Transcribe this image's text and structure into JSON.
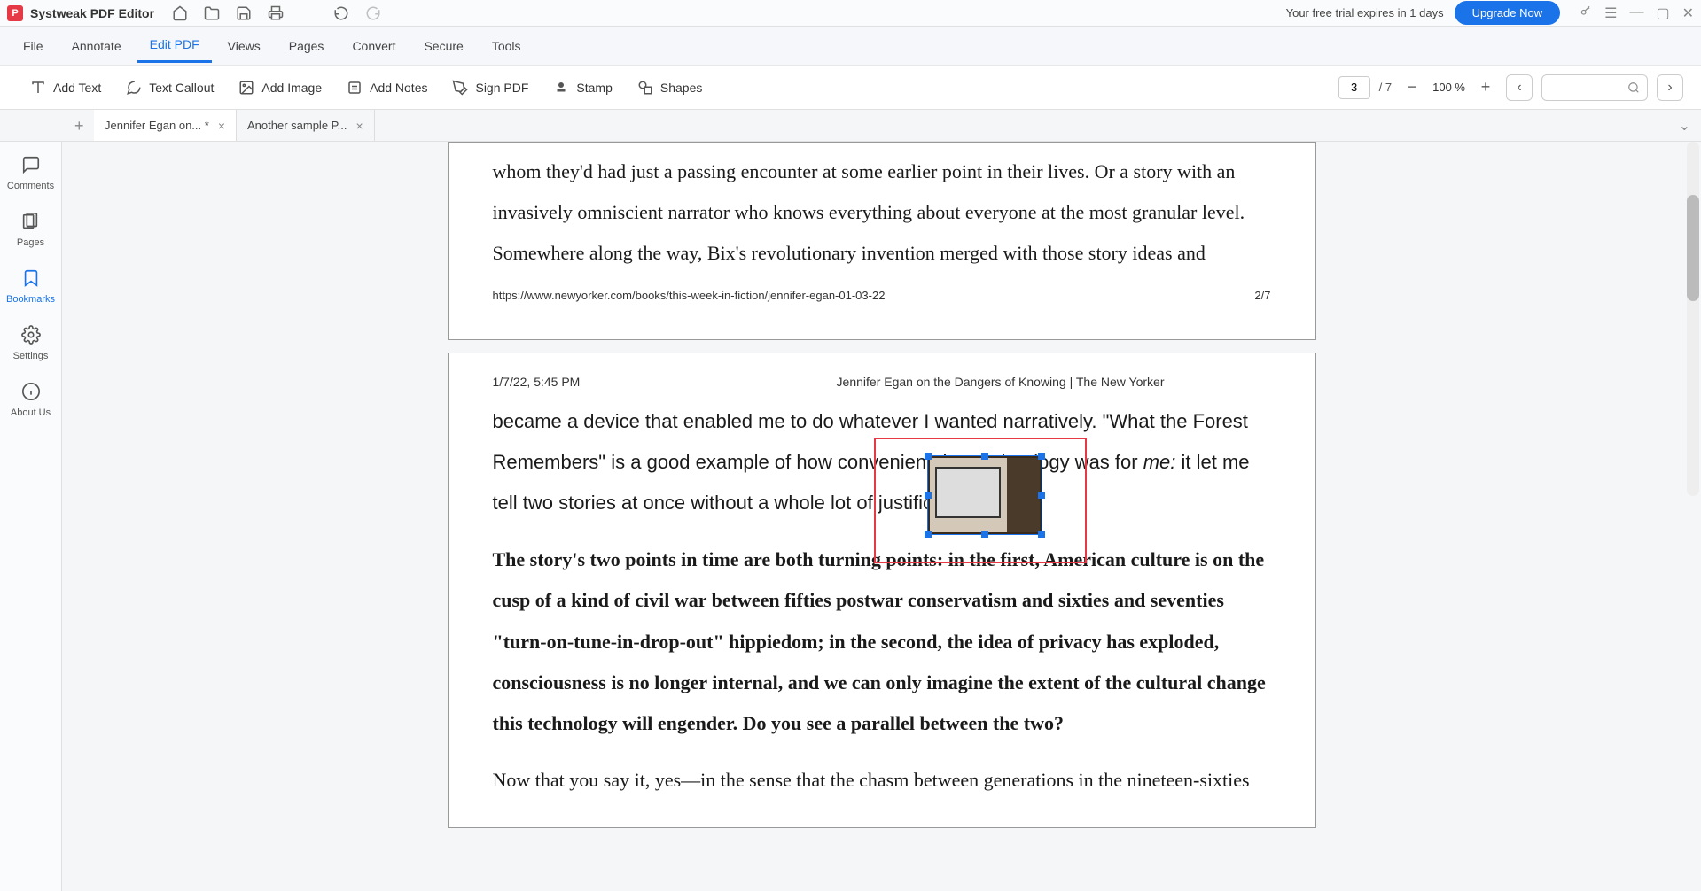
{
  "app": {
    "title": "Systweak PDF Editor",
    "trial": "Your free trial expires in 1 days",
    "upgrade": "Upgrade Now"
  },
  "menu": {
    "file": "File",
    "annotate": "Annotate",
    "edit": "Edit PDF",
    "views": "Views",
    "pages": "Pages",
    "convert": "Convert",
    "secure": "Secure",
    "tools": "Tools"
  },
  "tools": {
    "addtext": "Add Text",
    "callout": "Text Callout",
    "addimage": "Add Image",
    "addnotes": "Add Notes",
    "signpdf": "Sign PDF",
    "stamp": "Stamp",
    "shapes": "Shapes"
  },
  "paging": {
    "current": "3",
    "total": "/ 7",
    "zoom": "100 %"
  },
  "tabs": {
    "t1": "Jennifer Egan on... *",
    "t2": "Another sample P..."
  },
  "sidebar": {
    "comments": "Comments",
    "pages": "Pages",
    "bookmarks": "Bookmarks",
    "settings": "Settings",
    "about": "About Us"
  },
  "doc": {
    "p2_text": "whom they'd had just a passing encounter at some earlier point in their lives. Or a story with an invasively omniscient narrator who knows everything about everyone at the most granular level. Somewhere along the way, Bix's revolutionary invention merged with those story ideas and",
    "p2_url": "https://www.newyorker.com/books/this-week-in-fiction/jennifer-egan-01-03-22",
    "p2_num": "2/7",
    "p3_date": "1/7/22, 5:45 PM",
    "p3_title": "Jennifer Egan on the Dangers of Knowing | The New Yorker",
    "p3_para1a": "became a device that enabled me to do whatever I wanted narratively. \"What the Forest Remembers\" is a good example of how convenient that technology was for ",
    "p3_para1b": "me:",
    "p3_para1c": " it let me tell two stories at once without a whole lot of justification!",
    "p3_bold": "The story's two points in time are both turning points: in the first, American culture is on the cusp of a kind of civil war between fifties postwar conservatism and sixties and seventies \"turn-on-tune-in-drop-out\" hippiedom; in the second, the idea of privacy has exploded, consciousness is no longer internal, and we can only imagine the extent of the cultural change this technology will engender. Do you see a parallel between the two?",
    "p3_para2": "Now that you say it, yes—in the sense that the chasm between generations in the nineteen-sixties"
  }
}
